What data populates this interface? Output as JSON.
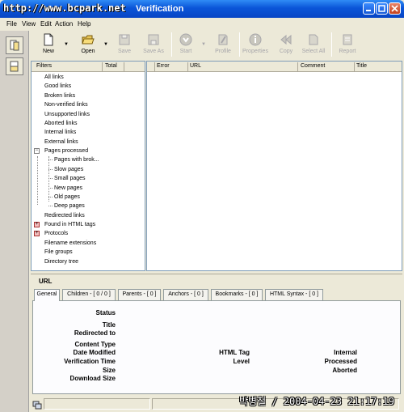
{
  "window": {
    "title": "Verification",
    "watermark": "http://www.bcpark.net"
  },
  "menu": [
    "File",
    "View",
    "Edit",
    "Action",
    "Help"
  ],
  "toolbar": {
    "new": "New",
    "open": "Open",
    "save": "Save",
    "save_as": "Save As",
    "start": "Start",
    "profile": "Profile",
    "properties": "Properties",
    "copy": "Copy",
    "select_all": "Select All",
    "report": "Report"
  },
  "filters": {
    "col_filters": "Filters",
    "col_total": "Total",
    "items": [
      "All links",
      "Good links",
      "Broken links",
      "Non-verified links",
      "Unsupported links",
      "Aborted links",
      "Internal links",
      "External links",
      "Pages processed",
      "Pages with brok...",
      "Slow pages",
      "Small pages",
      "New pages",
      "Old pages",
      "Deep pages",
      "Redirected links",
      "Found in HTML tags",
      "Protocols",
      "Filename extensions",
      "File groups",
      "Directory tree"
    ]
  },
  "results": {
    "columns": [
      "Error",
      "URL",
      "Comment",
      "Title"
    ]
  },
  "url_panel": {
    "label": "URL",
    "tabs": [
      "General",
      "Children - [ 0 / 0 ]",
      "Parents - [ 0 ]",
      "Anchors - [ 0 ]",
      "Bookmarks - [ 0 ]",
      "HTML Syntax - [ 0 ]"
    ],
    "fields_left": [
      "Status",
      "Title",
      "Redirected to",
      "Content Type",
      "Date Modified",
      "Verification Time",
      "Size",
      "Download Size"
    ],
    "fields_mid": [
      "HTML Tag",
      "Level"
    ],
    "fields_right": [
      "Internal",
      "Processed",
      "Aborted"
    ]
  },
  "stamp": "박병철 / 2004-04-23 21:17:19"
}
